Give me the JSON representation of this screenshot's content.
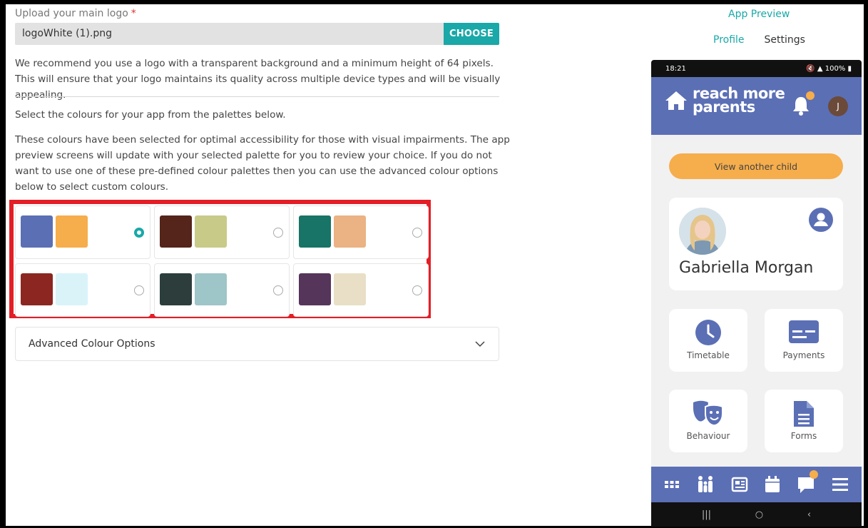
{
  "upload": {
    "label": "Upload your main logo",
    "required_mark": "*",
    "file_name": "logoWhite (1).png",
    "choose_label": "CHOOSE",
    "recommendation": "We recommend you use a logo with a transparent background and a minimum height of 64 pixels. This will ensure that your logo maintains its quality across multiple device types and will be visually appealing."
  },
  "colours": {
    "instruction": "Select the colours for your app from the palettes below.",
    "description": "These colours have been selected for optimal accessibility for those with visual impairments. The app preview screens will update with your selected palette for you to review your choice. If you do not want to use one of these pre-defined colour palettes then you can use the advanced colour options below to select custom colours.",
    "palettes": [
      {
        "primary": "#5b6fb5",
        "secondary": "#f6ad4b",
        "selected": true
      },
      {
        "primary": "#55241a",
        "secondary": "#c8ca88",
        "selected": false
      },
      {
        "primary": "#177466",
        "secondary": "#ebb283",
        "selected": false
      },
      {
        "primary": "#8b2720",
        "secondary": "#d9f3f9",
        "selected": false
      },
      {
        "primary": "#2c3d3c",
        "secondary": "#9ec5c8",
        "selected": false
      },
      {
        "primary": "#56355a",
        "secondary": "#e8dfc6",
        "selected": false
      }
    ],
    "advanced_label": "Advanced Colour Options"
  },
  "preview": {
    "title": "App Preview",
    "tabs": [
      "Profile",
      "Settings"
    ],
    "status_time": "18:21",
    "status_right": "100%",
    "brand_line1": "reach more",
    "brand_line2": "parents",
    "avatar_initial": "J",
    "view_child_label": "View another child",
    "child_name": "Gabriella Morgan",
    "tiles": [
      "Timetable",
      "Payments",
      "Behaviour",
      "Forms"
    ],
    "sys_nav": [
      "|||",
      "○",
      "‹"
    ]
  },
  "colors": {
    "accent": "#1aa8a8",
    "app_primary": "#5b6fb5",
    "app_secondary": "#f6ad4b",
    "highlight": "#e41e26"
  }
}
